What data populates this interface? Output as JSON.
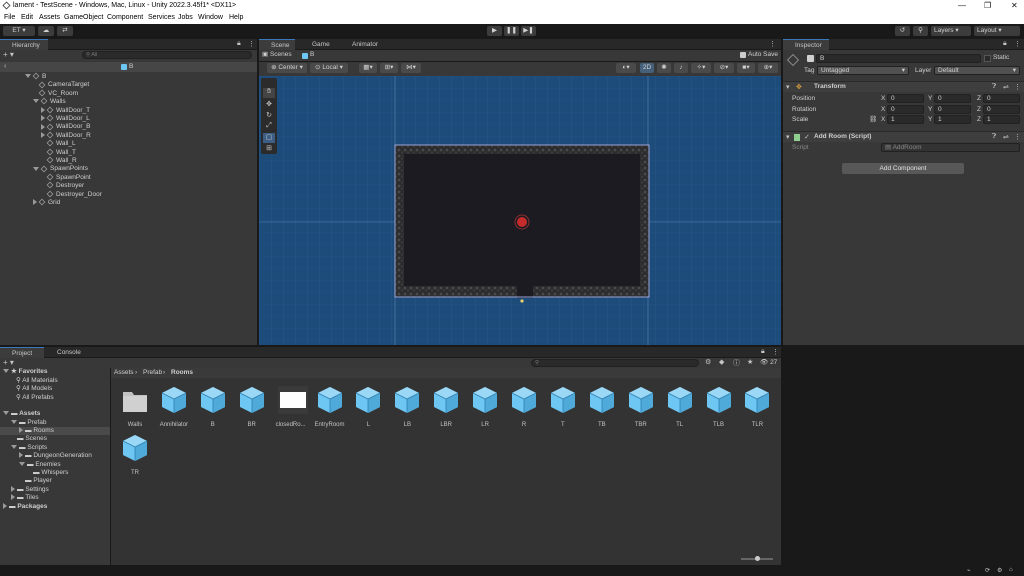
{
  "window": {
    "title": "lament - TestScene - Windows, Mac, Linux - Unity 2022.3.45f1* <DX11>",
    "controls": [
      "—",
      "❐",
      "✕"
    ]
  },
  "menu": [
    "File",
    "Edit",
    "Assets",
    "GameObject",
    "Component",
    "Services",
    "Jobs",
    "Window",
    "Help"
  ],
  "toolbar": {
    "account": "ET",
    "layers": "Layers",
    "layout": "Layout"
  },
  "hierarchy": {
    "tab": "Hierarchy",
    "search_placeholder": "All",
    "root": "B",
    "prefab_title": "B",
    "items": [
      {
        "label": "B",
        "indent": 0
      },
      {
        "label": "CameraTarget",
        "indent": 1
      },
      {
        "label": "VC_Room",
        "indent": 1
      },
      {
        "label": "Walls",
        "indent": 1
      },
      {
        "label": "WallDoor_T",
        "indent": 2
      },
      {
        "label": "WallDoor_L",
        "indent": 2
      },
      {
        "label": "WallDoor_B",
        "indent": 2
      },
      {
        "label": "WallDoor_R",
        "indent": 2
      },
      {
        "label": "Wall_L",
        "indent": 2
      },
      {
        "label": "Wall_T",
        "indent": 2
      },
      {
        "label": "Wall_R",
        "indent": 2
      },
      {
        "label": "SpawnPoints",
        "indent": 1
      },
      {
        "label": "SpawnPoint",
        "indent": 2
      },
      {
        "label": "Destroyer",
        "indent": 2
      },
      {
        "label": "Destroyer_Door",
        "indent": 2
      },
      {
        "label": "Grid",
        "indent": 1
      }
    ]
  },
  "scene": {
    "tabs": [
      "Scene",
      "Game",
      "Animator"
    ],
    "breadcrumb_root": "Scenes",
    "breadcrumb_prefab": "B",
    "auto_save": "Auto Save",
    "pivot": "Center",
    "space": "Local",
    "mode_2d": "2D"
  },
  "inspector": {
    "tab": "Inspector",
    "object_name": "B",
    "static_label": "Static",
    "tag_label": "Tag",
    "tag_value": "Untagged",
    "layer_label": "Layer",
    "layer_value": "Default",
    "transform": {
      "title": "Transform",
      "rows": [
        {
          "label": "Position",
          "x": "0",
          "y": "0",
          "z": "0"
        },
        {
          "label": "Rotation",
          "x": "0",
          "y": "0",
          "z": "0"
        },
        {
          "label": "Scale",
          "x": "1",
          "y": "1",
          "z": "1"
        }
      ]
    },
    "script_component": {
      "title": "Add Room (Script)",
      "script_label": "Script",
      "script_value": "AddRoom"
    },
    "add_component": "Add Component"
  },
  "project": {
    "tabs": [
      "Project",
      "Console"
    ],
    "breadcrumb": [
      "Assets",
      "Prefab",
      "Rooms"
    ],
    "count": "27",
    "favorites_label": "Favorites",
    "favorites": [
      "All Materials",
      "All Models",
      "All Prefabs"
    ],
    "assets_label": "Assets",
    "tree": [
      {
        "label": "Prefab",
        "indent": 1
      },
      {
        "label": "Rooms",
        "indent": 2
      },
      {
        "label": "Scenes",
        "indent": 1
      },
      {
        "label": "Scripts",
        "indent": 1
      },
      {
        "label": "DungeonGeneration",
        "indent": 2
      },
      {
        "label": "Enemies",
        "indent": 2
      },
      {
        "label": "Whispers",
        "indent": 3
      },
      {
        "label": "Player",
        "indent": 2
      },
      {
        "label": "Settings",
        "indent": 1
      },
      {
        "label": "Tiles",
        "indent": 1
      }
    ],
    "packages_label": "Packages",
    "assets": [
      "Walls",
      "Annihilator",
      "B",
      "BR",
      "closedRo...",
      "EntryRoom",
      "L",
      "LB",
      "LBR",
      "LR",
      "R",
      "T",
      "TB",
      "TBR",
      "TL",
      "TLB",
      "TLR",
      "TR"
    ]
  },
  "colors": {
    "accent": "#3a79bb",
    "prefab_blue": "#6ec6f2",
    "scene_bg": "#1d4b7a"
  }
}
